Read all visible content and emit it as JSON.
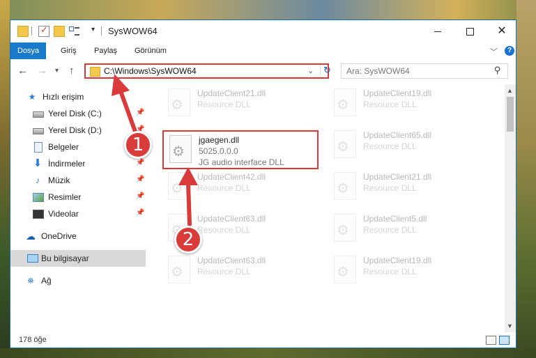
{
  "window": {
    "title": "SysWOW64"
  },
  "ribbon": {
    "tabs": [
      "Dosya",
      "Giriş",
      "Paylaş",
      "Görünüm"
    ],
    "help_label": "?"
  },
  "address": {
    "path": "C:\\Windows\\SysWOW64",
    "search_placeholder": "Ara: SysWOW64"
  },
  "sidebar": {
    "items": [
      {
        "label": "Hızlı erişim",
        "icon": "star-icon"
      },
      {
        "label": "Yerel Disk (C:)",
        "icon": "disk-icon",
        "pinned": true
      },
      {
        "label": "Yerel Disk (D:)",
        "icon": "disk-icon",
        "pinned": true
      },
      {
        "label": "Belgeler",
        "icon": "document-icon",
        "pinned": true
      },
      {
        "label": "İndirmeler",
        "icon": "download-icon",
        "pinned": true
      },
      {
        "label": "Müzik",
        "icon": "music-icon",
        "pinned": true
      },
      {
        "label": "Resimler",
        "icon": "pictures-icon",
        "pinned": true
      },
      {
        "label": "Videolar",
        "icon": "video-icon",
        "pinned": true
      },
      {
        "label": "OneDrive",
        "icon": "cloud-icon"
      },
      {
        "label": "Bu bilgisayar",
        "icon": "computer-icon",
        "selected": true
      },
      {
        "label": "Ağ",
        "icon": "network-icon"
      }
    ]
  },
  "files": [
    {
      "name": "UpdateClient21.dll",
      "type": "Resource DLL"
    },
    {
      "name": "UpdateClient19.dll",
      "type": "Resource DLL"
    },
    {
      "name": "UpdateClient65.dll",
      "type": "Resource DLL"
    },
    {
      "name": "UpdateClient42.dll",
      "type": "Resource DLL"
    },
    {
      "name": "UpdateClient21.dll",
      "type": "Resource DLL"
    },
    {
      "name": "UpdateClient63.dll",
      "type": "Resource DLL"
    },
    {
      "name": "UpdateClient5.dll",
      "type": "Resource DLL"
    },
    {
      "name": "UpdateClient63.dll",
      "type": "Resource DLL"
    },
    {
      "name": "UpdateClient19.dll",
      "type": "Resource DLL"
    }
  ],
  "highlighted_file": {
    "name": "jgaegen.dll",
    "version": "5025.0.0.0",
    "description": "JG audio interface DLL"
  },
  "status": {
    "item_count": "178 öğe"
  },
  "annotations": {
    "step1": "1",
    "step2": "2",
    "color": "#d93a3a"
  }
}
